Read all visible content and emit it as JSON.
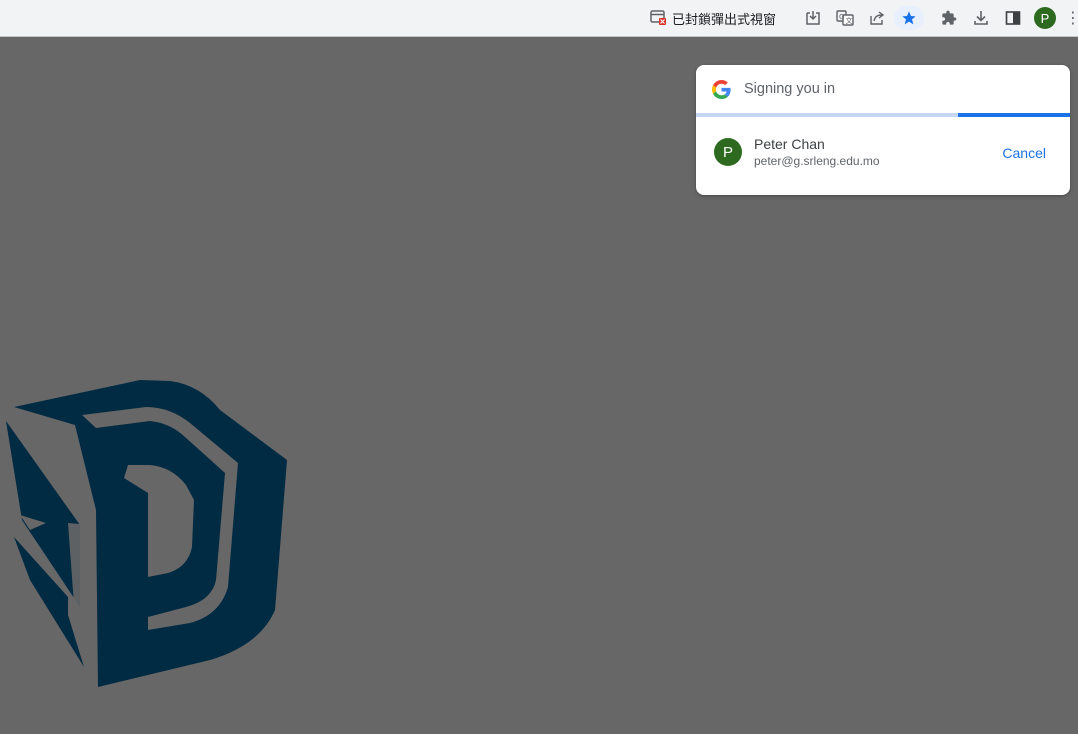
{
  "toolbar": {
    "popup_blocked_label": "已封鎖彈出式視窗",
    "icons": [
      "popup-blocked-icon",
      "install-app-icon",
      "translate-icon",
      "share-icon",
      "bookmark-star-icon",
      "extensions-icon",
      "downloads-icon",
      "side-panel-icon",
      "profile-avatar",
      "more-menu-icon"
    ],
    "avatar_initial": "P",
    "more_glyph": "⋮"
  },
  "signin": {
    "title": "Signing you in",
    "progress": 0.7,
    "account": {
      "initial": "P",
      "name": "Peter Chan",
      "email": "peter@g.srleng.edu.mo"
    },
    "cancel_label": "Cancel"
  },
  "colors": {
    "page_background": "#676767",
    "toolbar": "#f1f3f4",
    "accent": "#1a73e8",
    "avatar": "#2d6a1f",
    "logo": "#012a43"
  }
}
